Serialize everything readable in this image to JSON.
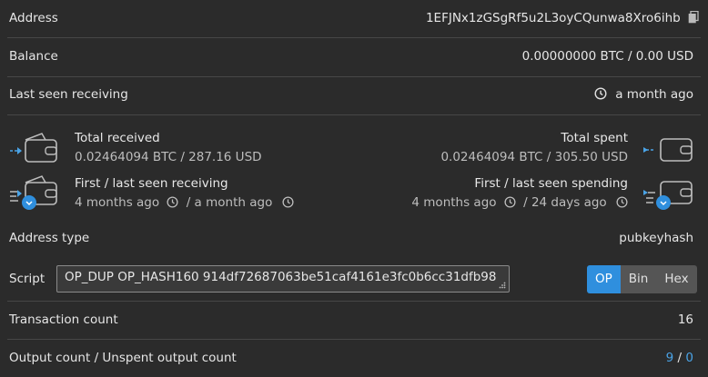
{
  "address": {
    "label": "Address",
    "value": "1EFJNx1zGSgRf5u2L3oyCQunwa8Xro6ihb",
    "copy_icon": "copy-icon"
  },
  "balance": {
    "label": "Balance",
    "btc": "0.00000000 BTC",
    "sep": "/",
    "usd": "0.00 USD"
  },
  "last_seen": {
    "label": "Last seen receiving",
    "value": "a month ago"
  },
  "total_received": {
    "title": "Total received",
    "value": "0.02464094 BTC / 287.16 USD"
  },
  "total_spent": {
    "title": "Total spent",
    "value": "0.02464094 BTC / 305.50 USD"
  },
  "first_last_receiving": {
    "title": "First / last seen receiving",
    "first": "4 months ago",
    "last": "/ a month ago"
  },
  "first_last_spending": {
    "title": "First / last seen spending",
    "first": "4 months ago",
    "last": "/ 24 days ago"
  },
  "address_type": {
    "label": "Address type",
    "value": "pubkeyhash"
  },
  "script": {
    "label": "Script",
    "value": "OP_DUP OP_HASH160 914df72687063be51caf4161e3fc0b6cc31dfb98",
    "formats": [
      "OP",
      "Bin",
      "Hex"
    ],
    "selected": "OP"
  },
  "tx_count": {
    "label": "Transaction count",
    "value": "16"
  },
  "output_count": {
    "label": "Output count / Unspent output count",
    "total": "9",
    "sep": "/",
    "unspent": "0"
  },
  "colors": {
    "accent": "#2f8fde",
    "link": "#4aa3e6",
    "background": "#2b2b2b"
  }
}
